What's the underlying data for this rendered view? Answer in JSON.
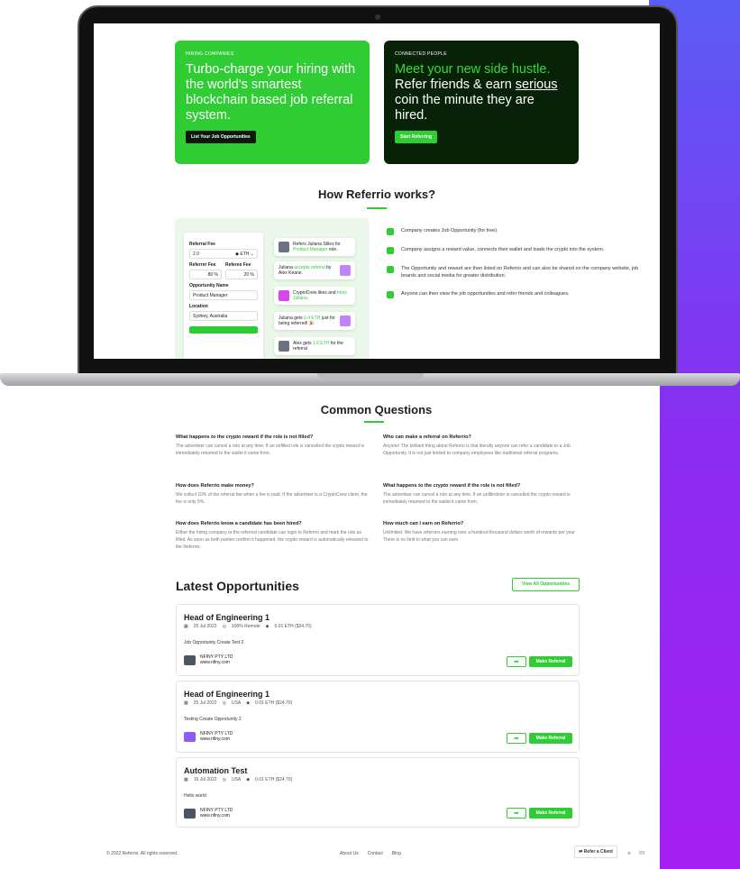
{
  "hero": {
    "hiring": {
      "kicker": "HIRING COMPANIES",
      "headline": "Turbo-charge your hiring with the world's smartest blockchain based job referral system.",
      "button": "List Your Job Opportunities"
    },
    "people": {
      "kicker": "CONNECTED PEOPLE",
      "headline_1": "Meet your new side hustle.",
      "headline_2": "Refer friends & earn ",
      "headline_3": "serious",
      "headline_4": " coin the minute they are hired.",
      "button": "Start Referring"
    }
  },
  "how": {
    "title": "How Referrio works?",
    "form": {
      "referral_fee_label": "Referral Fee",
      "referral_fee_value": "2.0",
      "currency": "ETH",
      "referrer_fee_label": "Referrer Fee",
      "referee_fee_label": "Referee Fee",
      "referrer_pct": "80 %",
      "referee_pct": "20 %",
      "opportunity_label": "Opportunity Name",
      "opportunity_value": "Product Manager",
      "location_label": "Location",
      "location_value": "Sydney, Australia"
    },
    "messages": [
      {
        "pre": "Refers Juliana Stiles for ",
        "green": "Product Manager",
        "post": " role."
      },
      {
        "pre": "Juliana ",
        "green": "accepts referral",
        "post": " by Alex Keane."
      },
      {
        "pre": "CryptoCrew likes and ",
        "green": "hires Juliana.",
        "post": ""
      },
      {
        "pre": "Juliana gets ",
        "green": "0.4 ETH",
        "post": " just for being referred! 🎉"
      },
      {
        "pre": "Alex gets ",
        "green": "1.6 ETH",
        "post": " for the referral"
      }
    ],
    "steps": [
      "Company creates Job Opportunity (for free).",
      "Company assigns a reward value, connects their wallet and loads the crypto into the system.",
      "The Opportunity and reward are then listed on Referrio and can also be shared on the company website, job boards and social media for greater distribution.",
      "Anyone can then view the job opportunities and refer friends and colleagues."
    ]
  },
  "faq": {
    "title": "Common Questions",
    "items": [
      {
        "q": "What happens to the crypto reward if the role is not filled?",
        "a": "The advertiser can cancel a role at any time, If an unfilled role is cancelled the crypto reward is immediately returned to the wallet it came from."
      },
      {
        "q": "Who can make a referral on Referrio?",
        "a": "Anyone! The brilliant thing about Referrio is that literally anyone can refer a candidate to a Job Opportunity. It is not just limited to company employees like traditional referral programs."
      },
      {
        "q": "How does Referrio make money?",
        "a": "We collect 10% of the referral fee when a fee is paid. If the advertiser is a CryptoCrew client, the fee is only 5%."
      },
      {
        "q": "What happens to the crypto reward if the role is not filled?",
        "a": "The advertiser can cancel a role at any time, If an unfilledrole is cancelled the crypto reward is immediately returned to the wallet it came from."
      },
      {
        "q": "How does Referrio know a candidate has been hired?",
        "a": "Either the hiring company or the referred candidate can login to Referrio and mark the role as filled. As soon as both parties confirm it happened, the crypto reward is automatically released to the Referrer."
      },
      {
        "q": "How much can I earn on Referrio?",
        "a": "Unlimited. We have referrers earning over a hundred thousand dollars worth of rewards per year There is no limit to what you can earn."
      }
    ]
  },
  "opportunities": {
    "title": "Latest Opportunities",
    "view_all": "View All Opportunities",
    "make_referral": "Make Referral",
    "items": [
      {
        "title": "Head of Engineering 1",
        "date": "25 Jul 2022",
        "location": "100% Remote",
        "reward": "0.01 ETH ($24.70)",
        "desc": "Job Opportunity Create Test 2",
        "company": "NFINY PTY LTD",
        "site": "www.nfiny.com",
        "logo": "#4b5563"
      },
      {
        "title": "Head of Engineering 1",
        "date": "25 Jul 2022",
        "location": "USA",
        "reward": "0.01 ETH ($24.70)",
        "desc": "Testing Create Opportunity 2",
        "company": "NFINY PTY LTD",
        "site": "www.nfiny.com",
        "logo": "#8b5cf6"
      },
      {
        "title": "Automation Test",
        "date": "16 Jul 2022",
        "location": "USA",
        "reward": "0.01 ETH ($24.70)",
        "desc": "Hello world",
        "company": "NFINY PTY LTD",
        "site": "www.nfiny.com",
        "logo": "#4b5563"
      }
    ]
  },
  "footer": {
    "copyright": "© 2022 Referrio. All rights reserved.",
    "links": [
      "About Us",
      "Contact",
      "Blog"
    ],
    "refer_client": "Refer a Client"
  },
  "colors": {
    "brand_green": "#2fcc34",
    "dark_green": "#082208",
    "purple": "#8a2df0"
  }
}
